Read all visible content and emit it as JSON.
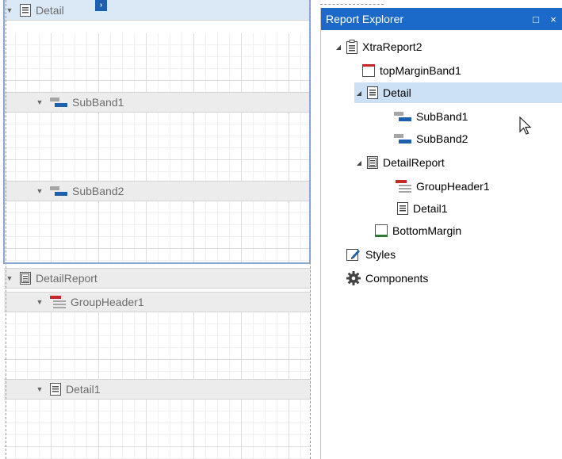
{
  "designer": {
    "bands": [
      {
        "id": "detail",
        "label": "Detail",
        "icon": "detail-band-icon"
      },
      {
        "id": "subband1",
        "label": "SubBand1",
        "icon": "subband-icon"
      },
      {
        "id": "subband2",
        "label": "SubBand2",
        "icon": "subband-icon"
      },
      {
        "id": "detailreport",
        "label": "DetailReport",
        "icon": "detail-report-icon"
      },
      {
        "id": "groupheader1",
        "label": "GroupHeader1",
        "icon": "group-header-icon"
      },
      {
        "id": "detail1",
        "label": "Detail1",
        "icon": "detail-band-icon"
      }
    ],
    "smart_tag": "›",
    "expand_glyph": "▼"
  },
  "explorer": {
    "title": "Report Explorer",
    "maximize_glyph": "□",
    "close_glyph": "×",
    "tree": [
      {
        "label": "XtraReport2",
        "icon": "report-icon",
        "expanded": true
      },
      {
        "label": "topMarginBand1",
        "icon": "top-margin-icon"
      },
      {
        "label": "Detail",
        "icon": "detail-band-icon",
        "expanded": true,
        "selected": true
      },
      {
        "label": "SubBand1",
        "icon": "subband-icon"
      },
      {
        "label": "SubBand2",
        "icon": "subband-icon"
      },
      {
        "label": "DetailReport",
        "icon": "detail-report-icon",
        "expanded": true
      },
      {
        "label": "GroupHeader1",
        "icon": "group-header-icon"
      },
      {
        "label": "Detail1",
        "icon": "detail-band-icon"
      },
      {
        "label": "BottomMargin",
        "icon": "bottom-margin-icon"
      },
      {
        "label": "Styles",
        "icon": "styles-icon"
      },
      {
        "label": "Components",
        "icon": "gear-icon"
      }
    ]
  },
  "colors": {
    "accent": "#1b6ac9",
    "selection": "#cde1f6",
    "band_header": "#ececec",
    "selected_band": "#dbe8f5"
  }
}
